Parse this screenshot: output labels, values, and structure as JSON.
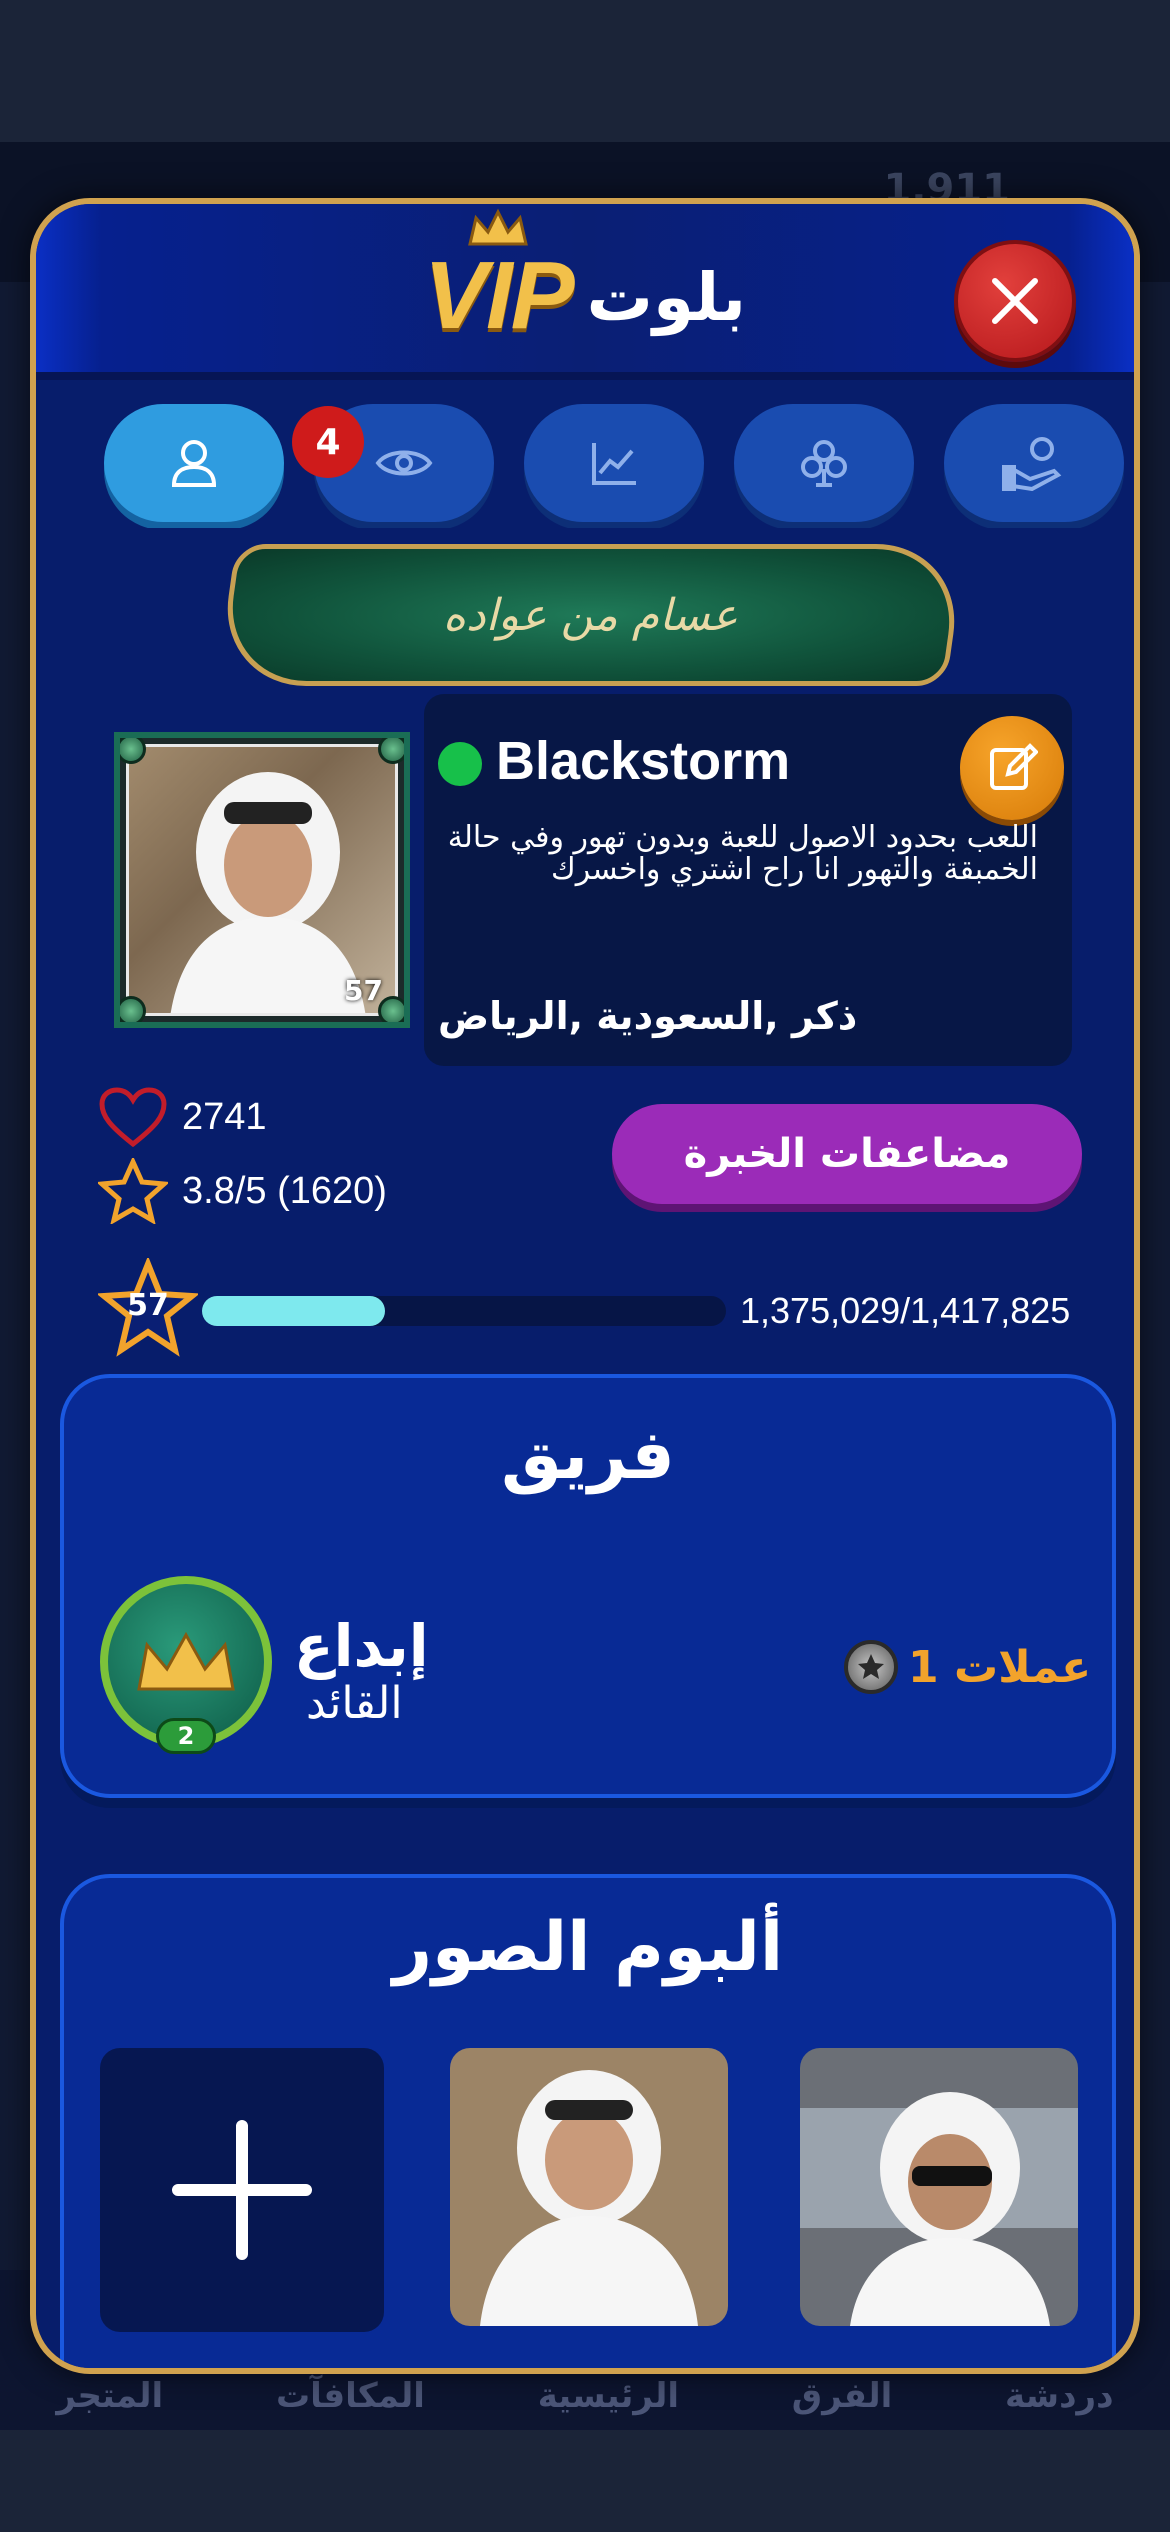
{
  "background": {
    "coins_value": "1,911",
    "tabbar": [
      "المتجر",
      "المكافآت",
      "الرئيسية",
      "الفرق",
      "دردشة"
    ]
  },
  "modal": {
    "logo": {
      "vip": "VIP",
      "name": "بلوت"
    },
    "tabs": [
      {
        "icon": "user-icon",
        "active": true
      },
      {
        "icon": "eye-icon",
        "badge": "4"
      },
      {
        "icon": "chart-icon"
      },
      {
        "icon": "club-icon"
      },
      {
        "icon": "money-hand-icon"
      }
    ],
    "name_frame_text": "عسام من عواده",
    "profile": {
      "avatar_level": "57",
      "username": "Blackstorm",
      "online": true,
      "bio": "اللعب بحدود الاصول للعبة وبدون تهور وفي حالة الخمبقة والتهور انا راح اشتري واخسرك",
      "location": "ذكر ,السعودية ,الرياض"
    },
    "stats": {
      "likes": "2741",
      "rating": "3.8/5 (1620)"
    },
    "xp_button_label": "مضاعفات الخبرة",
    "level": {
      "value": "57",
      "xp_text": "1,375,029/1,417,825",
      "progress": 0.35
    },
    "team": {
      "title": "فريق",
      "name": "إبداع",
      "role": "القائد",
      "emblem_level": "2",
      "coins": "عملات 1"
    },
    "album": {
      "title": "ألبوم الصور"
    }
  }
}
